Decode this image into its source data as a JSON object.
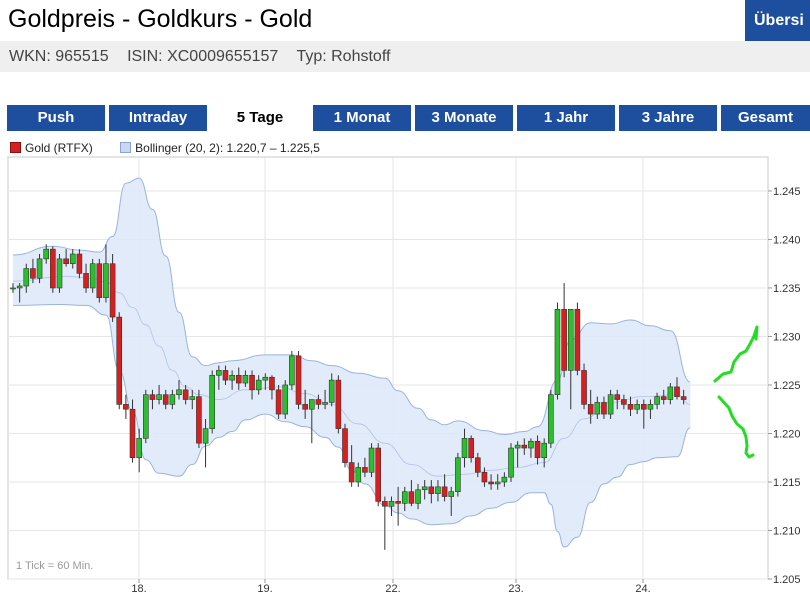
{
  "header": {
    "title": "Goldpreis - Goldkurs - Gold",
    "wkn": "WKN: 965515",
    "isin": "ISIN: XC0009655157",
    "typ": "Typ: Rohstoff",
    "overview_button": "Übersi"
  },
  "tabs": [
    {
      "label": "Push",
      "active": false
    },
    {
      "label": "Intraday",
      "active": false
    },
    {
      "label": "5 Tage",
      "active": true
    },
    {
      "label": "1 Monat",
      "active": false
    },
    {
      "label": "3 Monate",
      "active": false
    },
    {
      "label": "1 Jahr",
      "active": false
    },
    {
      "label": "3 Jahre",
      "active": false
    },
    {
      "label": "Gesamt",
      "active": false
    }
  ],
  "legend": {
    "gold": "Gold (RTFX)",
    "bollinger": "Bollinger (20, 2): 1.220,7 – 1.225,5"
  },
  "colors": {
    "brand": "#1d4f9e",
    "candle_up": "#2bc02b",
    "candle_down": "#d62020",
    "band_fill": "#dde8f8",
    "band_stroke": "#9bb4dc",
    "annotation": "#22dd22"
  },
  "chart_data": {
    "type": "candlestick",
    "ylim": [
      1.205,
      1.2485
    ],
    "yticks": [
      1.205,
      1.21,
      1.215,
      1.22,
      1.225,
      1.23,
      1.235,
      1.24,
      1.245
    ],
    "ytick_labels": [
      "1.205",
      "1.210",
      "1.215",
      "1.220",
      "1.225",
      "1.230",
      "1.235",
      "1.240",
      "1.245"
    ],
    "xticks": [
      "18.",
      "19.",
      "22.",
      "23.",
      "24."
    ],
    "tick_note": "1 Tick = 60 Min.",
    "candles": [
      [
        1.235,
        1.2355,
        1.2345,
        1.235
      ],
      [
        1.235,
        1.2355,
        1.2335,
        1.2352
      ],
      [
        1.2352,
        1.2375,
        1.2345,
        1.237
      ],
      [
        1.237,
        1.238,
        1.2355,
        1.236
      ],
      [
        1.236,
        1.2385,
        1.2355,
        1.238
      ],
      [
        1.238,
        1.2395,
        1.2375,
        1.239
      ],
      [
        1.239,
        1.2393,
        1.2345,
        1.235
      ],
      [
        1.235,
        1.2385,
        1.2345,
        1.238
      ],
      [
        1.238,
        1.239,
        1.2372,
        1.2375
      ],
      [
        1.2375,
        1.239,
        1.237,
        1.2385
      ],
      [
        1.2385,
        1.239,
        1.236,
        1.2365
      ],
      [
        1.2365,
        1.2375,
        1.2345,
        1.235
      ],
      [
        1.235,
        1.238,
        1.2345,
        1.2375
      ],
      [
        1.2375,
        1.238,
        1.2335,
        1.234
      ],
      [
        1.234,
        1.2395,
        1.2335,
        1.2375
      ],
      [
        1.2375,
        1.2385,
        1.2315,
        1.232
      ],
      [
        1.232,
        1.2325,
        1.2225,
        1.223
      ],
      [
        1.223,
        1.224,
        1.2215,
        1.2225
      ],
      [
        1.2225,
        1.2235,
        1.217,
        1.2175
      ],
      [
        1.2175,
        1.2205,
        1.216,
        1.2195
      ],
      [
        1.2195,
        1.2245,
        1.219,
        1.224
      ],
      [
        1.224,
        1.2245,
        1.2225,
        1.2235
      ],
      [
        1.2235,
        1.225,
        1.223,
        1.224
      ],
      [
        1.224,
        1.2245,
        1.2225,
        1.223
      ],
      [
        1.223,
        1.2245,
        1.2225,
        1.224
      ],
      [
        1.224,
        1.2255,
        1.2235,
        1.2245
      ],
      [
        1.2245,
        1.225,
        1.223,
        1.2235
      ],
      [
        1.2235,
        1.2245,
        1.2225,
        1.2238
      ],
      [
        1.2238,
        1.2245,
        1.2185,
        1.219
      ],
      [
        1.219,
        1.2215,
        1.2165,
        1.2205
      ],
      [
        1.2205,
        1.2265,
        1.22,
        1.226
      ],
      [
        1.226,
        1.227,
        1.2245,
        1.2265
      ],
      [
        1.2265,
        1.227,
        1.225,
        1.2255
      ],
      [
        1.2255,
        1.2265,
        1.2245,
        1.226
      ],
      [
        1.226,
        1.2268,
        1.2245,
        1.2252
      ],
      [
        1.2252,
        1.2265,
        1.2248,
        1.226
      ],
      [
        1.226,
        1.2265,
        1.2235,
        1.2245
      ],
      [
        1.2245,
        1.226,
        1.224,
        1.2255
      ],
      [
        1.2255,
        1.2262,
        1.2245,
        1.2258
      ],
      [
        1.2258,
        1.226,
        1.2235,
        1.2245
      ],
      [
        1.2245,
        1.225,
        1.2215,
        1.222
      ],
      [
        1.222,
        1.2255,
        1.2215,
        1.225
      ],
      [
        1.225,
        1.2285,
        1.2245,
        1.228
      ],
      [
        1.228,
        1.2285,
        1.2225,
        1.223
      ],
      [
        1.223,
        1.2245,
        1.2215,
        1.2225
      ],
      [
        1.2225,
        1.2235,
        1.219,
        1.2235
      ],
      [
        1.2235,
        1.224,
        1.2225,
        1.223
      ],
      [
        1.223,
        1.2245,
        1.2225,
        1.2232
      ],
      [
        1.2232,
        1.2262,
        1.2228,
        1.2255
      ],
      [
        1.2255,
        1.226,
        1.22,
        1.2205
      ],
      [
        1.2205,
        1.221,
        1.2165,
        1.217
      ],
      [
        1.217,
        1.2188,
        1.2145,
        1.215
      ],
      [
        1.215,
        1.217,
        1.2145,
        1.2165
      ],
      [
        1.2165,
        1.2175,
        1.2155,
        1.216
      ],
      [
        1.216,
        1.219,
        1.2155,
        1.2185
      ],
      [
        1.2185,
        1.219,
        1.2125,
        1.213
      ],
      [
        1.213,
        1.2135,
        1.208,
        1.2125
      ],
      [
        1.2125,
        1.2135,
        1.2115,
        1.213
      ],
      [
        1.213,
        1.2145,
        1.2105,
        1.2128
      ],
      [
        1.2128,
        1.2145,
        1.212,
        1.214
      ],
      [
        1.214,
        1.2152,
        1.2125,
        1.2128
      ],
      [
        1.2128,
        1.2148,
        1.2122,
        1.2142
      ],
      [
        1.2142,
        1.2152,
        1.2132,
        1.2145
      ],
      [
        1.2145,
        1.2152,
        1.2128,
        1.2138
      ],
      [
        1.2138,
        1.2152,
        1.213,
        1.2145
      ],
      [
        1.2145,
        1.2158,
        1.213,
        1.2135
      ],
      [
        1.2135,
        1.2145,
        1.2115,
        1.214
      ],
      [
        1.214,
        1.218,
        1.2135,
        1.2175
      ],
      [
        1.2175,
        1.2205,
        1.2165,
        1.2195
      ],
      [
        1.2195,
        1.2198,
        1.217,
        1.2175
      ],
      [
        1.2175,
        1.218,
        1.2155,
        1.216
      ],
      [
        1.216,
        1.2165,
        1.2145,
        1.215
      ],
      [
        1.215,
        1.2158,
        1.2142,
        1.2148
      ],
      [
        1.2148,
        1.2158,
        1.2142,
        1.215
      ],
      [
        1.215,
        1.216,
        1.2145,
        1.2155
      ],
      [
        1.2155,
        1.219,
        1.215,
        1.2185
      ],
      [
        1.2185,
        1.2192,
        1.2165,
        1.2188
      ],
      [
        1.2188,
        1.2195,
        1.2178,
        1.2185
      ],
      [
        1.2185,
        1.2195,
        1.2175,
        1.2192
      ],
      [
        1.2192,
        1.2198,
        1.2168,
        1.2175
      ],
      [
        1.2175,
        1.2195,
        1.2165,
        1.219
      ],
      [
        1.219,
        1.2245,
        1.2185,
        1.224
      ],
      [
        1.224,
        1.2335,
        1.2235,
        1.2328
      ],
      [
        1.2328,
        1.2355,
        1.2258,
        1.2265
      ],
      [
        1.2265,
        1.2328,
        1.2225,
        1.2328
      ],
      [
        1.2328,
        1.2335,
        1.226,
        1.2265
      ],
      [
        1.2265,
        1.2272,
        1.2225,
        1.223
      ],
      [
        1.223,
        1.2245,
        1.221,
        1.222
      ],
      [
        1.222,
        1.2238,
        1.2215,
        1.2232
      ],
      [
        1.2232,
        1.2238,
        1.2215,
        1.222
      ],
      [
        1.222,
        1.2245,
        1.2215,
        1.224
      ],
      [
        1.224,
        1.2245,
        1.2225,
        1.2235
      ],
      [
        1.2235,
        1.224,
        1.2225,
        1.223
      ],
      [
        1.223,
        1.2238,
        1.2218,
        1.2225
      ],
      [
        1.2225,
        1.2235,
        1.222,
        1.223
      ],
      [
        1.223,
        1.2235,
        1.2205,
        1.2225
      ],
      [
        1.2225,
        1.2235,
        1.2215,
        1.223
      ],
      [
        1.223,
        1.2242,
        1.2225,
        1.2238
      ],
      [
        1.2238,
        1.2245,
        1.223,
        1.2235
      ],
      [
        1.2235,
        1.2252,
        1.223,
        1.2248
      ],
      [
        1.2248,
        1.2258,
        1.2235,
        1.2238
      ],
      [
        1.2238,
        1.2245,
        1.223,
        1.2235
      ]
    ],
    "bollinger_upper": [
      [
        0,
        1.2384
      ],
      [
        6,
        1.2393
      ],
      [
        10,
        1.2389
      ],
      [
        13,
        1.2387
      ],
      [
        15,
        1.2403
      ],
      [
        17,
        1.2458
      ],
      [
        19,
        1.2463
      ],
      [
        21,
        1.2431
      ],
      [
        23,
        1.2383
      ],
      [
        25,
        1.2325
      ],
      [
        27,
        1.2279
      ],
      [
        29,
        1.227
      ],
      [
        31,
        1.2273
      ],
      [
        33,
        1.2275
      ],
      [
        38,
        1.2281
      ],
      [
        42,
        1.2281
      ],
      [
        45,
        1.2275
      ],
      [
        48,
        1.227
      ],
      [
        52,
        1.2262
      ],
      [
        56,
        1.2257
      ],
      [
        58,
        1.2244
      ],
      [
        61,
        1.2226
      ],
      [
        63,
        1.2214
      ],
      [
        65,
        1.2209
      ],
      [
        67,
        1.2213
      ],
      [
        71,
        1.2203
      ],
      [
        74,
        1.2199
      ],
      [
        77,
        1.2202
      ],
      [
        79,
        1.2207
      ],
      [
        82,
        1.2255
      ],
      [
        84,
        1.2297
      ],
      [
        87,
        1.2314
      ],
      [
        90,
        1.2313
      ],
      [
        93,
        1.2317
      ],
      [
        96,
        1.2311
      ],
      [
        99,
        1.2306
      ],
      [
        102,
        1.2253
      ]
    ],
    "bollinger_lower": [
      [
        0,
        1.2332
      ],
      [
        7,
        1.2333
      ],
      [
        11,
        1.2332
      ],
      [
        14,
        1.2322
      ],
      [
        16,
        1.2265
      ],
      [
        18,
        1.2223
      ],
      [
        20,
        1.2173
      ],
      [
        22,
        1.2159
      ],
      [
        25,
        1.2156
      ],
      [
        27,
        1.2168
      ],
      [
        29,
        1.2187
      ],
      [
        31,
        1.2196
      ],
      [
        33,
        1.2202
      ],
      [
        35,
        1.2214
      ],
      [
        38,
        1.222
      ],
      [
        41,
        1.2212
      ],
      [
        44,
        1.2207
      ],
      [
        47,
        1.2196
      ],
      [
        49,
        1.2186
      ],
      [
        51,
        1.2162
      ],
      [
        53,
        1.2148
      ],
      [
        56,
        1.2126
      ],
      [
        58,
        1.2118
      ],
      [
        60,
        1.2112
      ],
      [
        63,
        1.2106
      ],
      [
        66,
        1.2107
      ],
      [
        69,
        1.2115
      ],
      [
        72,
        1.2123
      ],
      [
        75,
        1.2129
      ],
      [
        78,
        1.2139
      ],
      [
        80,
        1.2139
      ],
      [
        81,
        1.2127
      ],
      [
        82,
        1.2099
      ],
      [
        83,
        1.2083
      ],
      [
        85,
        1.2093
      ],
      [
        87,
        1.2129
      ],
      [
        89,
        1.2148
      ],
      [
        91,
        1.2155
      ],
      [
        93,
        1.2168
      ],
      [
        95,
        1.2171
      ],
      [
        97,
        1.2175
      ],
      [
        100,
        1.2176
      ],
      [
        102,
        1.2206
      ]
    ],
    "bollinger_middle": [
      [
        0,
        1.2357
      ],
      [
        8,
        1.2362
      ],
      [
        12,
        1.236
      ],
      [
        14,
        1.2356
      ],
      [
        16,
        1.2345
      ],
      [
        18,
        1.233
      ],
      [
        20,
        1.2312
      ],
      [
        22,
        1.229
      ],
      [
        24,
        1.2265
      ],
      [
        26,
        1.2248
      ],
      [
        28,
        1.224
      ],
      [
        31,
        1.2235
      ],
      [
        35,
        1.2245
      ],
      [
        40,
        1.2248
      ],
      [
        44,
        1.2241
      ],
      [
        48,
        1.223
      ],
      [
        52,
        1.221
      ],
      [
        56,
        1.219
      ],
      [
        60,
        1.2168
      ],
      [
        64,
        1.2156
      ],
      [
        68,
        1.2158
      ],
      [
        72,
        1.2162
      ],
      [
        76,
        1.2165
      ],
      [
        80,
        1.217
      ],
      [
        83,
        1.2195
      ],
      [
        86,
        1.2215
      ],
      [
        90,
        1.2232
      ],
      [
        95,
        1.2238
      ],
      [
        100,
        1.224
      ],
      [
        102,
        1.223
      ]
    ]
  }
}
